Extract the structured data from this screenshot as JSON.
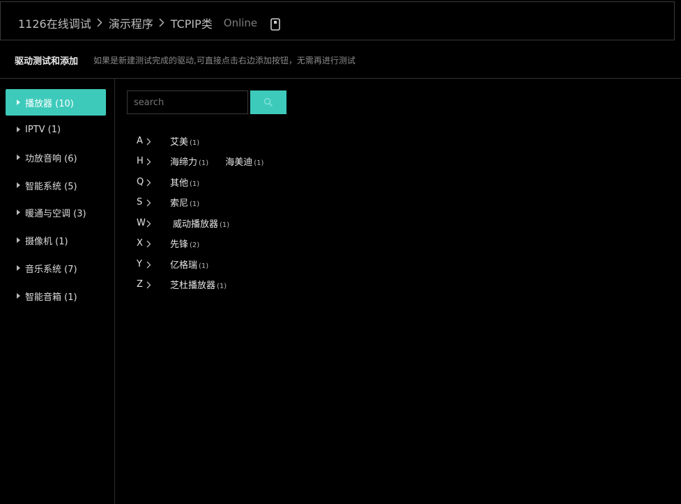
{
  "header": {
    "breadcrumbs": [
      "1126在线调试",
      "演示程序",
      "TCPIP类"
    ],
    "separator": ">",
    "status": "Online",
    "icon": "device-icon"
  },
  "subheader": {
    "title": "驱动测试和添加",
    "description": "如果是新建测试完成的驱动,可直接点击右边添加按钮，无需再进行测试"
  },
  "sidebar": {
    "items": [
      {
        "label": "播放器 (10)",
        "active": true
      },
      {
        "label": "IPTV (1)",
        "active": false
      },
      {
        "label": "功放音响 (6)",
        "active": false
      },
      {
        "label": "智能系统 (5)",
        "active": false
      },
      {
        "label": "暖通与空调 (3)",
        "active": false
      },
      {
        "label": "摄像机 (1)",
        "active": false
      },
      {
        "label": "音乐系统 (7)",
        "active": false
      },
      {
        "label": "智能音箱 (1)",
        "active": false
      }
    ]
  },
  "search": {
    "placeholder": "search",
    "value": "",
    "button_icon": "search-icon"
  },
  "brands": [
    {
      "letter": "A",
      "items": [
        {
          "name": "艾美",
          "count": "(1)"
        }
      ]
    },
    {
      "letter": "H",
      "items": [
        {
          "name": "海缔力",
          "count": "(1)"
        },
        {
          "name": "海美迪",
          "count": "(1)"
        }
      ]
    },
    {
      "letter": "Q",
      "items": [
        {
          "name": "其他",
          "count": "(1)"
        }
      ]
    },
    {
      "letter": "S",
      "items": [
        {
          "name": "索尼",
          "count": "(1)"
        }
      ]
    },
    {
      "letter": "W",
      "items": [
        {
          "name": "威动播放器",
          "count": "(1)"
        }
      ]
    },
    {
      "letter": "X",
      "items": [
        {
          "name": "先锋",
          "count": "(2)"
        }
      ]
    },
    {
      "letter": "Y",
      "items": [
        {
          "name": "亿格瑞",
          "count": "(1)"
        }
      ]
    },
    {
      "letter": "Z",
      "items": [
        {
          "name": "芝杜播放器",
          "count": "(1)"
        }
      ]
    }
  ],
  "colors": {
    "accent": "#3ecabb",
    "background": "#000000"
  }
}
